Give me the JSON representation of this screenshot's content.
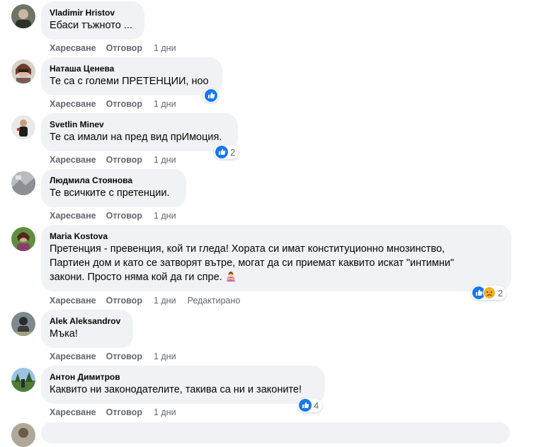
{
  "actions": {
    "like": "Харесване",
    "reply": "Отговор"
  },
  "comments": [
    {
      "author": "Vladimir Hristov",
      "lines": [
        "Ебаси тъжното ..."
      ],
      "time": "1 дни"
    },
    {
      "author": "Наташа Ценева",
      "lines": [
        "Те са с големи ПРЕТЕНЦИИ, ноо"
      ],
      "time": "1 дни"
    },
    {
      "author": "Svetlin Minev",
      "lines": [
        "Те са имали на пред вид прИмоция."
      ],
      "time": "1 дни",
      "reaction_count": "2"
    },
    {
      "author": "Людмила Стоянова",
      "lines": [
        "Те всичките с претенции."
      ],
      "time": "1 дни"
    },
    {
      "author": "Maria Kostova",
      "lines": [
        "Претенция - превенция, кой ти гледа! Хората си имат конституционно мнозинство,",
        "Партиен дом и като се затворят вътре, могат да си приемат каквито искат \"интимни\"",
        "закони. Просто няма кой да ги спре."
      ],
      "time": "1 дни",
      "edited": "Редактирано",
      "reaction_count": "2"
    },
    {
      "author": "Alek Aleksandrov",
      "lines": [
        "Мъка!"
      ],
      "time": "1 дни"
    },
    {
      "author": "Антон Димитров",
      "lines": [
        "Каквито ни законодателите, такива са ни и законите!"
      ],
      "time": "1 дни",
      "reaction_count": "4"
    }
  ],
  "icons": {
    "like_reaction": "like-icon",
    "sad_reaction": "sad-icon",
    "inline_emoji": "woman-gesturing-no-icon"
  },
  "colors": {
    "bubble": "#f0f2f5",
    "meta": "#65676b",
    "like_blue": "#1877f2"
  }
}
